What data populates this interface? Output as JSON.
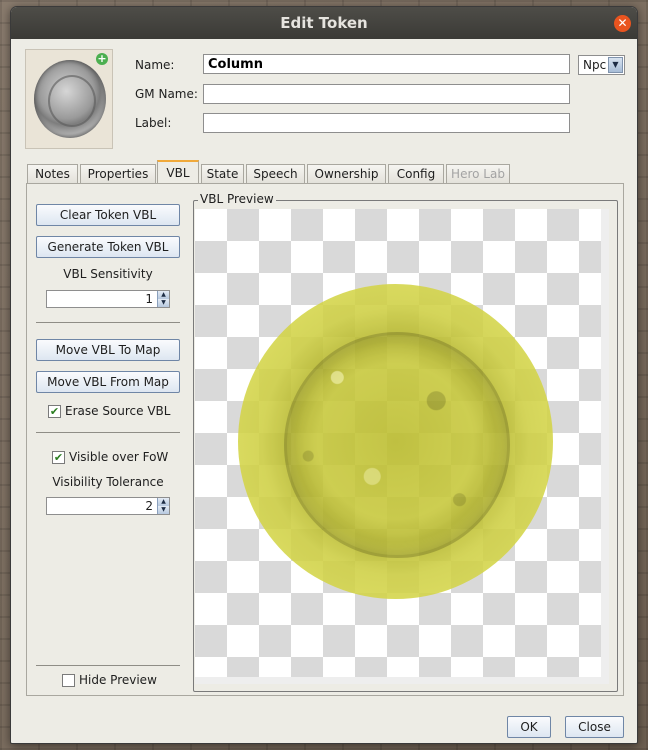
{
  "window": {
    "title": "Edit Token"
  },
  "token": {
    "name_label": "Name:",
    "name_value": "Column",
    "gm_name_label": "GM Name:",
    "gm_name_value": "",
    "label_label": "Label:",
    "label_value": "",
    "type_value": "Npc"
  },
  "tabs": [
    {
      "label": "Notes"
    },
    {
      "label": "Properties"
    },
    {
      "label": "VBL"
    },
    {
      "label": "State"
    },
    {
      "label": "Speech"
    },
    {
      "label": "Ownership"
    },
    {
      "label": "Config"
    },
    {
      "label": "Hero Lab"
    }
  ],
  "vbl": {
    "clear_label": "Clear Token VBL",
    "generate_label": "Generate Token VBL",
    "sensitivity_label": "VBL Sensitivity",
    "sensitivity_value": "1",
    "move_to_map_label": "Move VBL To Map",
    "move_from_map_label": "Move VBL From Map",
    "erase_source_label": "Erase Source VBL",
    "erase_source_checked": true,
    "visible_fow_label": "Visible over FoW",
    "visible_fow_checked": true,
    "tolerance_label": "Visibility Tolerance",
    "tolerance_value": "2",
    "hide_preview_label": "Hide Preview",
    "hide_preview_checked": false,
    "preview_title": "VBL Preview",
    "overlay_color": "#d2d33f"
  },
  "footer": {
    "ok_label": "OK",
    "close_label": "Close"
  }
}
